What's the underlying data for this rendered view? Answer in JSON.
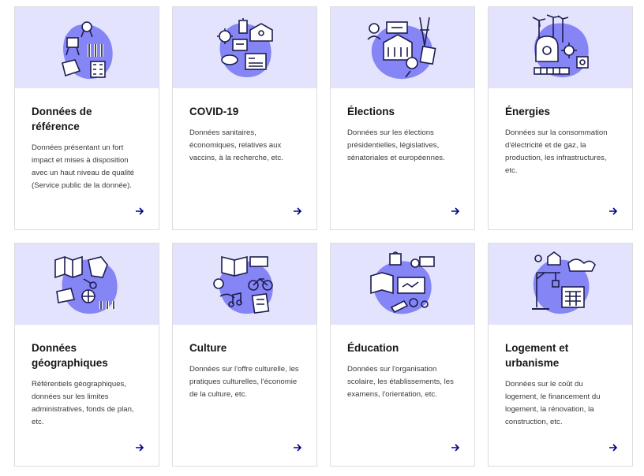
{
  "accent": "#000091",
  "illustration_bg": "#e3e3fd",
  "blob_color": "#8585f6",
  "cards": [
    {
      "title": "Données de\nréférence",
      "description": "Données présentant un fort impact et mises à disposition avec un haut niveau de qualité (Service public de la donnée).",
      "icon": "reference-data-illustration"
    },
    {
      "title": "COVID-19",
      "description": "Données sanitaires, économiques, relatives aux vaccins, à la recherche, etc.",
      "icon": "covid-illustration"
    },
    {
      "title": "Élections",
      "description": "Données sur les élections présidentielles, législatives, sénatoriales et européennes.",
      "icon": "elections-illustration"
    },
    {
      "title": "Énergies",
      "description": "Données sur la consommation d'électricité et de gaz, la production, les infrastructures, etc.",
      "icon": "energies-illustration"
    },
    {
      "title": "Données\ngéographiques",
      "description": "Référentiels géographiques, données sur les limites administratives, fonds de plan, etc.",
      "icon": "geography-illustration"
    },
    {
      "title": "Culture",
      "description": "Données sur l'offre culturelle, les pratiques culturelles, l'économie de la culture, etc.",
      "icon": "culture-illustration"
    },
    {
      "title": "Éducation",
      "description": "Données sur l'organisation scolaire, les établissements, les examens, l'orientation, etc.",
      "icon": "education-illustration"
    },
    {
      "title": "Logement et\nurbanisme",
      "description": "Données sur le coût du logement, le financement du logement, la rénovation, la construction, etc.",
      "icon": "housing-illustration"
    }
  ]
}
